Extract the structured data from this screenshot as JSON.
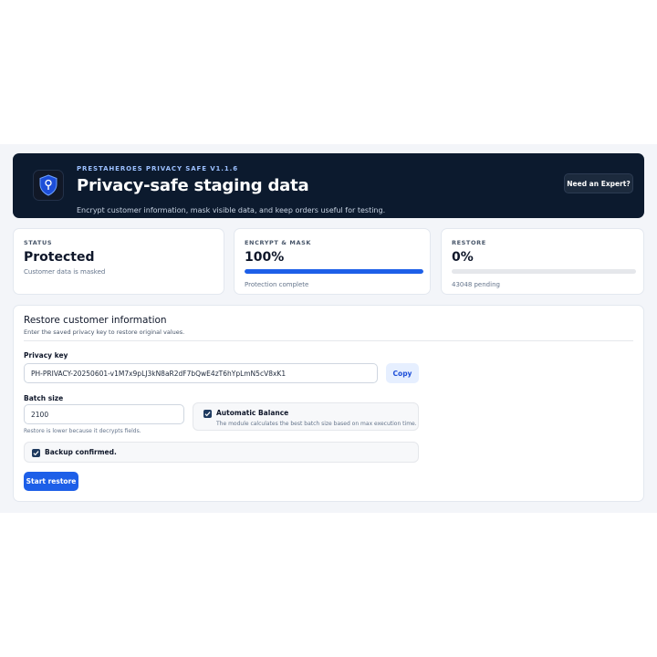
{
  "header": {
    "kicker": "PRESTAHEROES PRIVACY SAFE V1.1.6",
    "title": "Privacy-safe staging data",
    "subtitle": "Encrypt customer information, mask visible data, and keep orders useful for testing.",
    "expert_button": "Need an Expert?",
    "logo_icon": "shield-lock-icon"
  },
  "stats": {
    "status": {
      "label": "STATUS",
      "value": "Protected",
      "note": "Customer data is masked"
    },
    "encrypt": {
      "label": "ENCRYPT & MASK",
      "value": "100%",
      "progress": 1.0,
      "note": "Protection complete"
    },
    "restore": {
      "label": "RESTORE",
      "value": "0%",
      "progress": 0.0,
      "note": "43048 pending"
    }
  },
  "restore_form": {
    "title": "Restore customer information",
    "subtitle": "Enter the saved privacy key to restore original values.",
    "privacy_key_label": "Privacy key",
    "privacy_key_value": "PH-PRIVACY-20250601-v1M7x9pLJ3kN8aR2dF7bQwE4zT6hYpLmN5cV8xK1",
    "copy_button": "Copy",
    "batch_size_label": "Batch size",
    "batch_size_value": "2100",
    "batch_help": "Restore is lower because it decrypts fields.",
    "auto_balance_title": "Automatic Balance",
    "auto_balance_desc": "The module calculates the best batch size based on max execution time.",
    "auto_balance_checked": true,
    "backup_label": "Backup confirmed.",
    "backup_checked": true,
    "start_button": "Start restore"
  },
  "colors": {
    "hero_bg": "#0c1a2e",
    "accent": "#1d5fe8",
    "checkbox": "#1e3a5f"
  }
}
